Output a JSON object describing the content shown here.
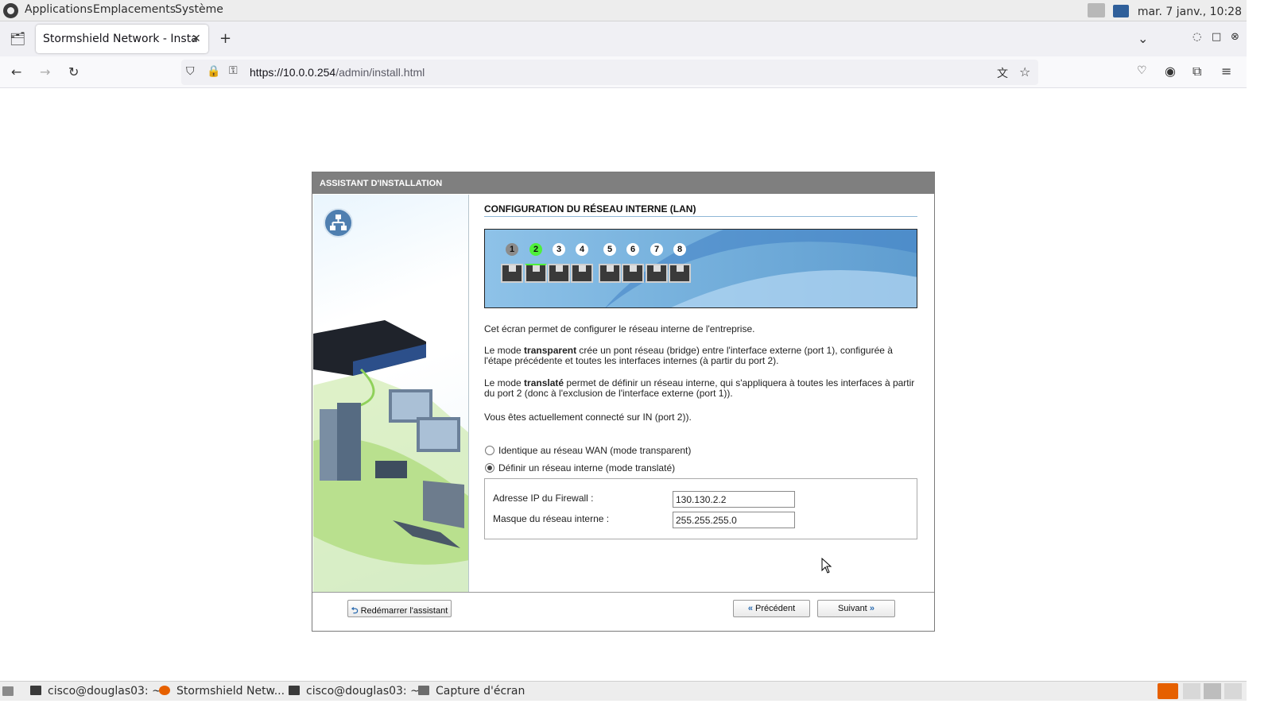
{
  "panel": {
    "menus": [
      "Applications",
      "Emplacements",
      "Système"
    ],
    "clock": "mar. 7 janv., 10:28"
  },
  "browser": {
    "tab_title": "Stormshield Network - Insta",
    "url_host": "https://10.0.0.254",
    "url_path": "/admin/install.html"
  },
  "wizard": {
    "header": "ASSISTANT D'INSTALLATION",
    "section_title": "CONFIGURATION DU RÉSEAU INTERNE (LAN)",
    "ports": [
      "1",
      "2",
      "3",
      "4",
      "5",
      "6",
      "7",
      "8"
    ],
    "active_port": "2",
    "intro": "Cet écran permet de configurer le réseau interne de l'entreprise.",
    "transparent_text": {
      "before": "Le mode ",
      "bold": "transparent",
      "after": " crée un pont réseau (bridge) entre l'interface externe (port 1), configurée à l'étape précédente et toutes les interfaces internes (à partir du port 2)."
    },
    "translated_text": {
      "before": "Le mode ",
      "bold": "translaté",
      "after": " permet de définir un réseau interne, qui s'appliquera à toutes les interfaces à partir du port 2 (donc à l'exclusion de l'interface externe (port 1))."
    },
    "connected_text": "Vous êtes actuellement connecté sur IN (port 2)).",
    "options": {
      "transparent": "Identique au réseau WAN (mode transparent)",
      "translated": "Définir un réseau interne (mode translaté)",
      "selected": "translated"
    },
    "fields": {
      "ip_label": "Adresse IP du Firewall :",
      "ip_value": "130.130.2.2",
      "mask_label": "Masque du réseau interne :",
      "mask_value": "255.255.255.0"
    },
    "buttons": {
      "restart": "Redémarrer l'assistant",
      "previous": "Précédent",
      "next": "Suivant"
    }
  },
  "taskbar": {
    "items": [
      "cisco@douglas03: ~",
      "Stormshield Netw...",
      "cisco@douglas03: ~",
      "Capture d'écran"
    ]
  }
}
